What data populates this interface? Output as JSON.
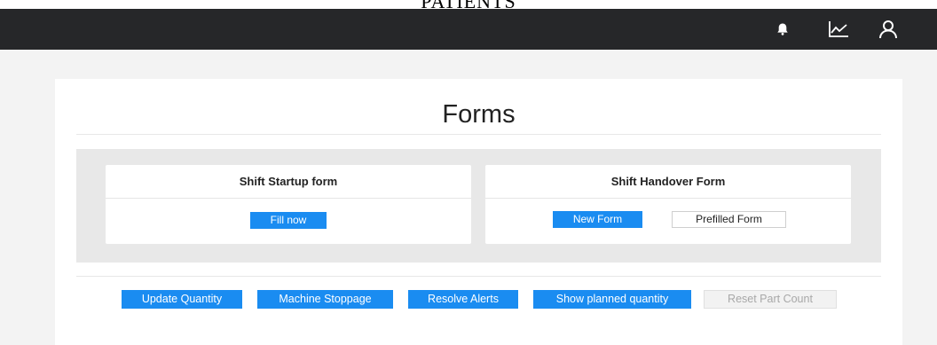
{
  "top_caption": "PATIENTS",
  "navbar": {
    "icons": [
      "bell-icon",
      "chart-line-icon",
      "user-icon"
    ]
  },
  "page": {
    "title": "Forms"
  },
  "forms": {
    "startup": {
      "title": "Shift Startup form",
      "fill_label": "Fill now"
    },
    "handover": {
      "title": "Shift Handover Form",
      "new_label": "New Form",
      "prefilled_label": "Prefilled Form"
    }
  },
  "actions": {
    "update_quantity": "Update Quantity",
    "machine_stoppage": "Machine Stoppage",
    "resolve_alerts": "Resolve Alerts",
    "show_planned_quantity": "Show planned quantity",
    "reset_part_count": "Reset Part Count"
  },
  "colors": {
    "navbar": "#262729",
    "primary": "#1a8cf1",
    "panel": "#e8e8e8",
    "background": "#f3f3f3"
  }
}
